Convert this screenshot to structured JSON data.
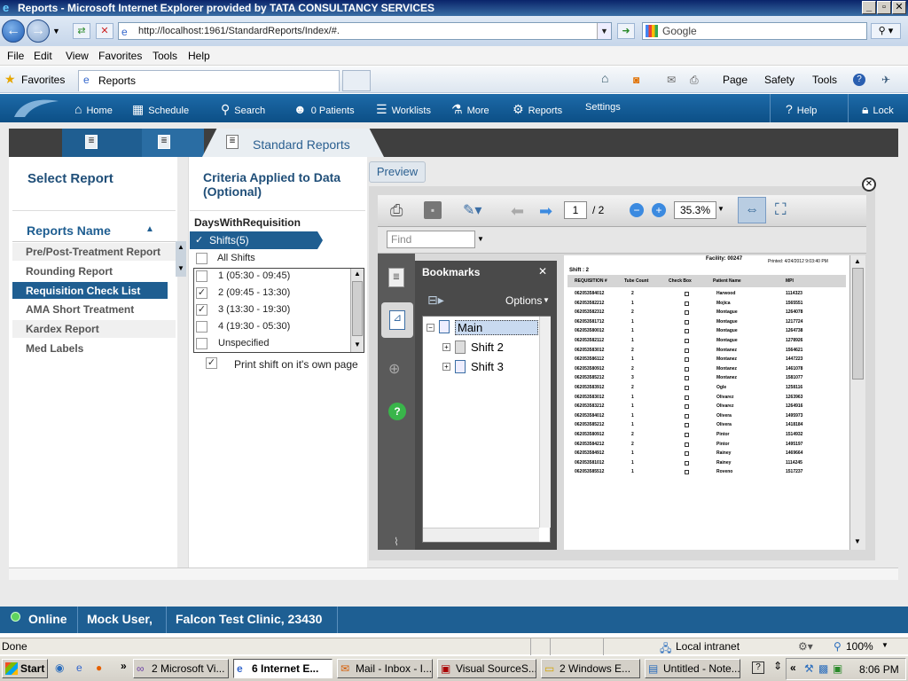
{
  "window": {
    "title": "Reports - Microsoft Internet Explorer provided by TATA CONSULTANCY SERVICES"
  },
  "address": {
    "url": "http://localhost:1961/StandardReports/Index/#.",
    "search_placeholder": "Google"
  },
  "menubar": [
    "File",
    "Edit",
    "View",
    "Favorites",
    "Tools",
    "Help"
  ],
  "favbar": {
    "favorites": "Favorites",
    "tab_title": "Reports",
    "page": "Page",
    "safety": "Safety",
    "tools": "Tools"
  },
  "appnav": {
    "items": [
      {
        "label": "Home",
        "icon": "home-icon"
      },
      {
        "label": "Schedule",
        "icon": "calendar-icon"
      },
      {
        "label": "Search",
        "icon": "search-icon"
      },
      {
        "label": "0 Patients",
        "icon": "patients-icon"
      },
      {
        "label": "Worklists",
        "icon": "list-icon"
      },
      {
        "label": "More",
        "icon": "more-icon"
      },
      {
        "label": "Reports",
        "icon": "gear-icon"
      },
      {
        "label": "Settings",
        "icon": ""
      }
    ],
    "help": "Help",
    "lock": "Lock"
  },
  "tabs": {
    "active": "Standard Reports"
  },
  "left": {
    "title": "Select Report",
    "reports_header": "Reports Name",
    "reports": [
      "Pre/Post-Treatment Report",
      "Rounding Report",
      "Requisition Check List",
      "AMA Short Treatment",
      "Kardex Report",
      "Med Labels"
    ],
    "selected": "Requisition Check List"
  },
  "middle": {
    "criteria_line1": "Criteria Applied to Data",
    "criteria_line2": "(Optional)",
    "section": "DaysWithRequisition",
    "shifts_header": "Shifts(5)",
    "all_shifts": "All Shifts",
    "shifts": [
      {
        "label": "1 (05:30 - 09:45)",
        "checked": false
      },
      {
        "label": "2 (09:45 - 13:30)",
        "checked": true
      },
      {
        "label": "3 (13:30 - 19:30)",
        "checked": true
      },
      {
        "label": "4 (19:30 - 05:30)",
        "checked": false
      },
      {
        "label": "Unspecified",
        "checked": false
      }
    ],
    "print_own_page": "Print shift on it's own page",
    "print_own_page_checked": true
  },
  "preview": {
    "button": "Preview",
    "page_current": "1",
    "page_total": "/ 2",
    "zoom": "35.3%",
    "find_placeholder": "Find",
    "bookmarks_title": "Bookmarks",
    "options": "Options",
    "tree": [
      "Main",
      "Shift 2",
      "Shift 3"
    ],
    "doc": {
      "facility": "Facility: 00247",
      "printed": "Printed: 4/24/2012 9:03:40 PM",
      "shift": "Shift : 2",
      "columns": [
        "REQUISITION #",
        "Tube Count",
        "Check Box",
        "Patient Name",
        "MPI"
      ],
      "rows": [
        [
          "062053584012",
          "2",
          "Harwood",
          "1114323"
        ],
        [
          "062053582212",
          "1",
          "Mojica",
          "1565551"
        ],
        [
          "062053582312",
          "2",
          "Montague",
          "1264078"
        ],
        [
          "062053581712",
          "1",
          "Montague",
          "1217724"
        ],
        [
          "062053580012",
          "1",
          "Montague",
          "1264738"
        ],
        [
          "062053582112",
          "1",
          "Montague",
          "1278926"
        ],
        [
          "062053583012",
          "2",
          "Montanez",
          "1564621"
        ],
        [
          "062053586112",
          "1",
          "Montanez",
          "1447223"
        ],
        [
          "062053580912",
          "2",
          "Montanez",
          "1461078"
        ],
        [
          "062053585212",
          "3",
          "Montanez",
          "1581077"
        ],
        [
          "062053583912",
          "2",
          "Ogle",
          "1258116"
        ],
        [
          "062053583012",
          "1",
          "Olivarez",
          "1263963"
        ],
        [
          "062053583212",
          "1",
          "Olivarez",
          "1264916"
        ],
        [
          "062053584012",
          "1",
          "Olivera",
          "1495973"
        ],
        [
          "062053585212",
          "1",
          "Olivera",
          "1418184"
        ],
        [
          "062053580912",
          "2",
          "Pintor",
          "1514932"
        ],
        [
          "062053584212",
          "2",
          "Pintor",
          "1495197"
        ],
        [
          "062053584912",
          "1",
          "Rainey",
          "1469664"
        ],
        [
          "062053581012",
          "1",
          "Rainey",
          "1114245"
        ],
        [
          "062053585512",
          "1",
          "Roveno",
          "1517237"
        ]
      ]
    }
  },
  "status_app": {
    "online": "Online",
    "user": "Mock User,",
    "clinic": "Falcon Test Clinic, 23430"
  },
  "ie_status": {
    "left": "Done",
    "zone": "Local intranet",
    "zoom": "100%"
  },
  "taskbar": {
    "start": "Start",
    "tasks": [
      "2 Microsoft Vi...",
      "6 Internet E...",
      "Mail - Inbox - I...",
      "Visual SourceS...",
      "2 Windows E...",
      "Untitled - Note..."
    ],
    "clock": "8:06 PM"
  }
}
